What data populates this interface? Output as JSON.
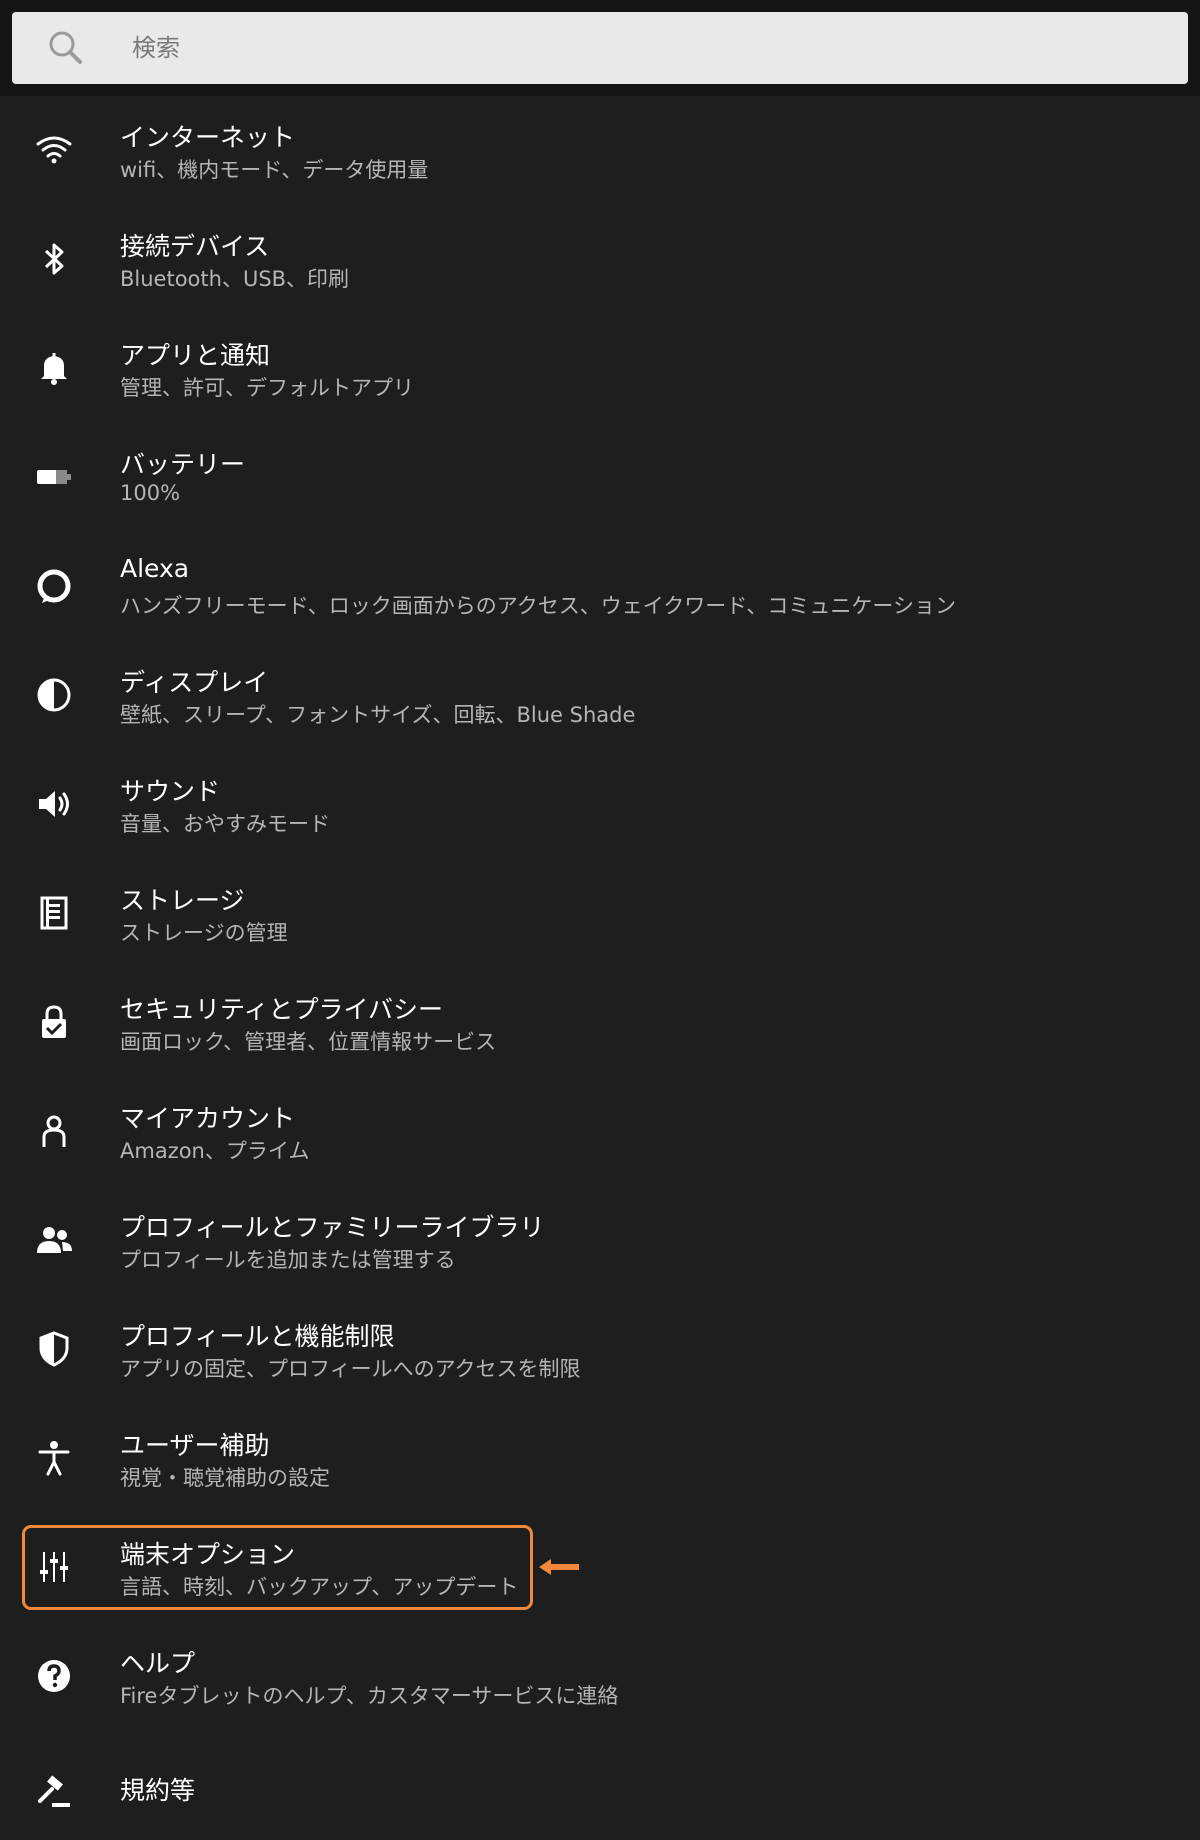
{
  "search": {
    "placeholder": "検索",
    "icon": "search-icon"
  },
  "settings": [
    {
      "id": "internet",
      "icon": "wifi-icon",
      "title": "インターネット",
      "subtitle": "wifi、機内モード、データ使用量"
    },
    {
      "id": "connected-devices",
      "icon": "bluetooth-icon",
      "title": "接続デバイス",
      "subtitle": "Bluetooth、USB、印刷"
    },
    {
      "id": "apps-notifications",
      "icon": "bell-icon",
      "title": "アプリと通知",
      "subtitle": "管理、許可、デフォルトアプリ"
    },
    {
      "id": "battery",
      "icon": "battery-icon",
      "title": "バッテリー",
      "subtitle": "100%"
    },
    {
      "id": "alexa",
      "icon": "alexa-icon",
      "title": "Alexa",
      "subtitle": "ハンズフリーモード、ロック画面からのアクセス、ウェイクワード、コミュニケーション"
    },
    {
      "id": "display",
      "icon": "contrast-icon",
      "title": "ディスプレイ",
      "subtitle": "壁紙、スリープ、フォントサイズ、回転、Blue Shade"
    },
    {
      "id": "sound",
      "icon": "speaker-icon",
      "title": "サウンド",
      "subtitle": "音量、おやすみモード"
    },
    {
      "id": "storage",
      "icon": "storage-icon",
      "title": "ストレージ",
      "subtitle": "ストレージの管理"
    },
    {
      "id": "security-privacy",
      "icon": "lock-icon",
      "title": "セキュリティとプライバシー",
      "subtitle": "画面ロック、管理者、位置情報サービス"
    },
    {
      "id": "my-account",
      "icon": "person-icon",
      "title": "マイアカウント",
      "subtitle": "Amazon、プライム"
    },
    {
      "id": "profiles-family",
      "icon": "people-icon",
      "title": "プロフィールとファミリーライブラリ",
      "subtitle": "プロフィールを追加または管理する"
    },
    {
      "id": "profiles-restrictions",
      "icon": "shield-icon",
      "title": "プロフィールと機能制限",
      "subtitle": "アプリの固定、プロフィールへのアクセスを制限"
    },
    {
      "id": "accessibility",
      "icon": "accessibility-icon",
      "title": "ユーザー補助",
      "subtitle": "視覚・聴覚補助の設定"
    },
    {
      "id": "device-options",
      "icon": "sliders-icon",
      "title": "端末オプション",
      "subtitle": "言語、時刻、バックアップ、アップデート"
    },
    {
      "id": "help",
      "icon": "help-icon",
      "title": "ヘルプ",
      "subtitle": "Fireタブレットのヘルプ、カスタマーサービスに連絡"
    },
    {
      "id": "legal",
      "icon": "gavel-icon",
      "title": "規約等",
      "subtitle": ""
    }
  ],
  "highlight": {
    "target": "device-options",
    "color": "#f08a3a"
  },
  "colors": {
    "background": "#1e1e1e",
    "search_bg": "#e9e9e9",
    "accent": "#f08a3a"
  }
}
